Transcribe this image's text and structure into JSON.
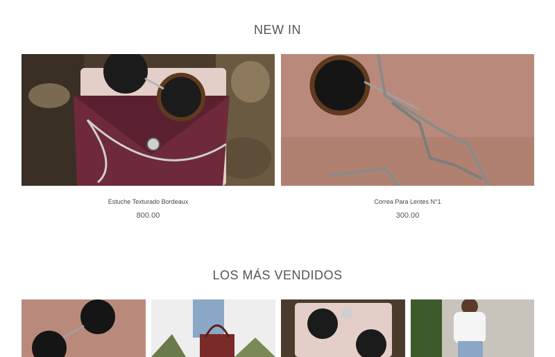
{
  "new_in": {
    "title": "NEW IN",
    "products": [
      {
        "name": "Estuche Texturado Bordeaux",
        "price": "800.00",
        "image": "bordeaux-case-with-sunglasses"
      },
      {
        "name": "Correa Para Lentes N°1",
        "price": "300.00",
        "image": "sunglasses-chain-on-suede"
      }
    ]
  },
  "best_sellers": {
    "title": "LOS MÁS VENDIDOS",
    "products": [
      {
        "image": "sunglasses-on-suede"
      },
      {
        "image": "woman-with-tote-bag"
      },
      {
        "image": "case-with-sunglasses"
      },
      {
        "image": "woman-in-white-top"
      }
    ]
  },
  "colors": {
    "heading": "#555555",
    "background": "#ffffff",
    "burgundy": "#6e2a3a",
    "suede": "#b98a7b"
  }
}
